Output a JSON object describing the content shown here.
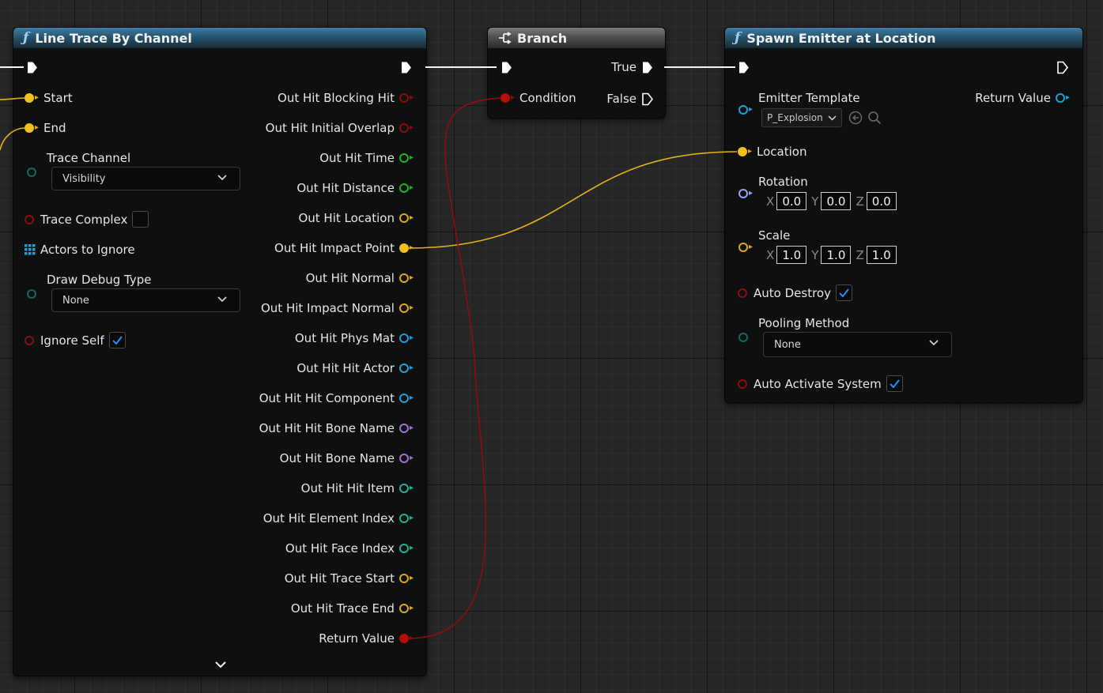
{
  "colors": {
    "function_header": "#27556f",
    "branch_header": "#505050",
    "exec_pin": "#ffffff",
    "vector_pin": "#f2c01d",
    "bool_pin": "#b80d0d",
    "float_pin": "#20b320",
    "object_pin": "#1f9fd8",
    "name_pin": "#9e74d8",
    "int_pin": "#1fb096",
    "rotator_pin": "#9aa3f0",
    "checkbox_check": "#1f8ffb"
  },
  "line_trace": {
    "title": "Line Trace By Channel",
    "icon": "function-icon",
    "inputs": {
      "start": "Start",
      "end": "End",
      "trace_channel": "Trace Channel",
      "trace_channel_value": "Visibility",
      "trace_complex": "Trace Complex",
      "trace_complex_checked": false,
      "actors_to_ignore": "Actors to Ignore",
      "draw_debug_type": "Draw Debug Type",
      "draw_debug_value": "None",
      "ignore_self": "Ignore Self",
      "ignore_self_checked": true
    },
    "outputs": [
      {
        "label": "Out Hit Blocking Hit",
        "type": "bool"
      },
      {
        "label": "Out Hit Initial Overlap",
        "type": "bool"
      },
      {
        "label": "Out Hit Time",
        "type": "float"
      },
      {
        "label": "Out Hit Distance",
        "type": "float"
      },
      {
        "label": "Out Hit Location",
        "type": "vector"
      },
      {
        "label": "Out Hit Impact Point",
        "type": "vector-connected"
      },
      {
        "label": "Out Hit Normal",
        "type": "vector"
      },
      {
        "label": "Out Hit Impact Normal",
        "type": "vector"
      },
      {
        "label": "Out Hit Phys Mat",
        "type": "object"
      },
      {
        "label": "Out Hit Hit Actor",
        "type": "object"
      },
      {
        "label": "Out Hit Hit Component",
        "type": "object"
      },
      {
        "label": "Out Hit Hit Bone Name",
        "type": "name"
      },
      {
        "label": "Out Hit Bone Name",
        "type": "name"
      },
      {
        "label": "Out Hit Hit Item",
        "type": "int"
      },
      {
        "label": "Out Hit Element Index",
        "type": "int"
      },
      {
        "label": "Out Hit Face Index",
        "type": "int"
      },
      {
        "label": "Out Hit Trace Start",
        "type": "vector"
      },
      {
        "label": "Out Hit Trace End",
        "type": "vector"
      },
      {
        "label": "Return Value",
        "type": "bool-connected"
      }
    ]
  },
  "branch": {
    "title": "Branch",
    "icon": "branch-icon",
    "condition": "Condition",
    "true_label": "True",
    "false_label": "False"
  },
  "spawn_emitter": {
    "title": "Spawn Emitter at Location",
    "icon": "function-icon",
    "emitter_template": "Emitter Template",
    "emitter_value": "P_Explosion",
    "return_value": "Return Value",
    "location": "Location",
    "rotation": "Rotation",
    "rotation_values": {
      "x": "0.0",
      "y": "0.0",
      "z": "0.0"
    },
    "scale": "Scale",
    "scale_values": {
      "x": "1.0",
      "y": "1.0",
      "z": "1.0"
    },
    "axis_labels": {
      "x": "X",
      "y": "Y",
      "z": "Z"
    },
    "auto_destroy": "Auto Destroy",
    "auto_destroy_checked": true,
    "pooling_method": "Pooling Method",
    "pooling_value": "None",
    "auto_activate": "Auto Activate System",
    "auto_activate_checked": true
  }
}
